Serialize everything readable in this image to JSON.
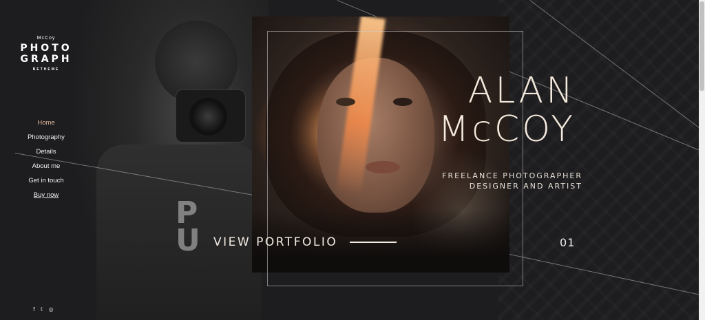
{
  "logo": {
    "small": "McCoy",
    "big_line1": "PHOTO",
    "big_line2": "GRAPH",
    "sub": "BETHEME"
  },
  "nav": {
    "items": [
      {
        "label": "Home",
        "active": true
      },
      {
        "label": "Photography"
      },
      {
        "label": "Details"
      },
      {
        "label": "About me"
      },
      {
        "label": "Get in touch"
      },
      {
        "label": "Buy now"
      }
    ]
  },
  "social": {
    "icons": [
      "facebook-icon",
      "twitter-icon",
      "instagram-icon"
    ],
    "glyphs": [
      "f",
      "𝕥",
      "◎"
    ]
  },
  "hero": {
    "name_line1": "ALAN",
    "name_line2": "McCOY",
    "tagline_line1": "FREELANCE PHOTOGRAPHER",
    "tagline_line2": "DESIGNER AND ARTIST",
    "cta_label": "VIEW PORTFOLIO",
    "slide_number": "01"
  },
  "colors": {
    "background": "#1d1c1e",
    "accent_nav_active": "#e0b89a",
    "hero_text": "#f3e9dc"
  }
}
